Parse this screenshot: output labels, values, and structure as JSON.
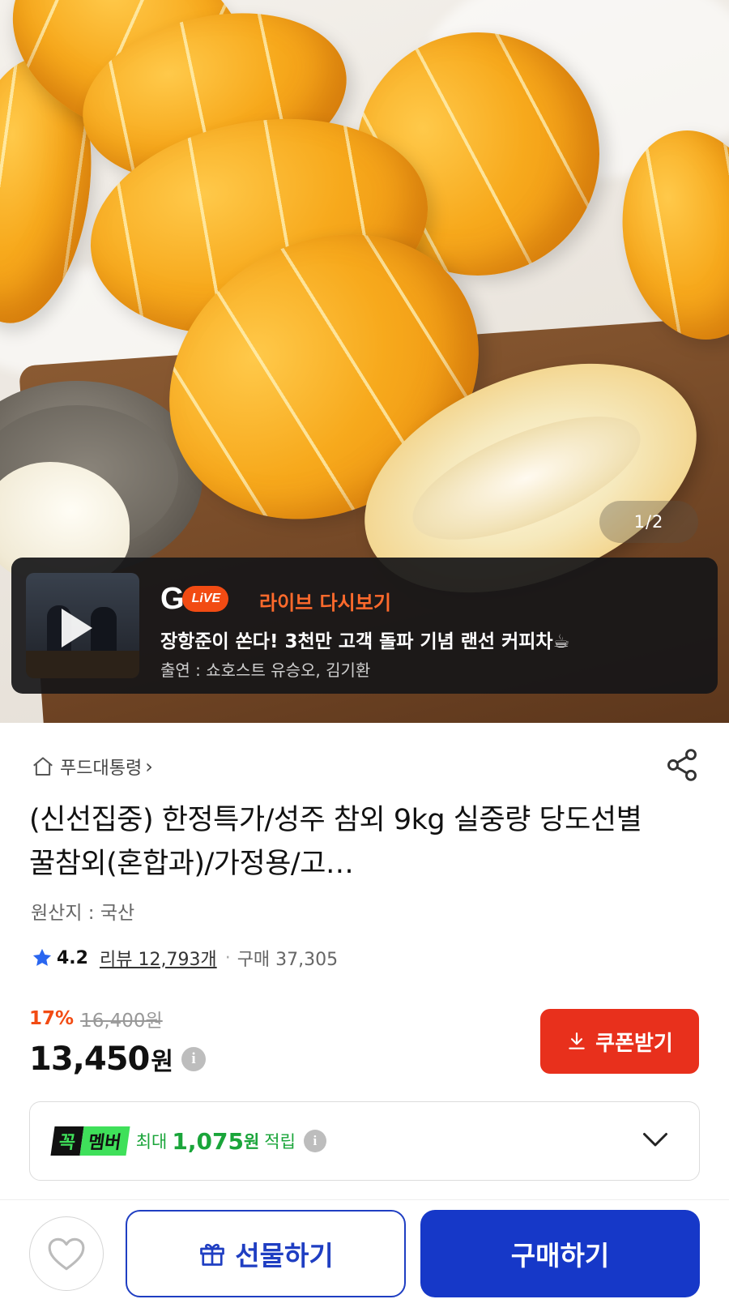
{
  "hero": {
    "pager": "1/2",
    "image_subject": "melons-photo"
  },
  "live": {
    "brand_pill": "LiVE",
    "label": "라이브 다시보기",
    "title": "장항준이 쏜다! 3천만 고객 돌파 기념 랜선 커피차☕",
    "cast": "출연 : 쇼호스트 유승오, 김기환"
  },
  "breadcrumb": {
    "category": "푸드대통령",
    "chevron": "›"
  },
  "product": {
    "title": "(신선집중) 한정특가/성주 참외 9kg 실중량 당도선별 꿀참외(혼합과)/가정용/고…",
    "origin": "원산지 : 국산",
    "rating": "4.2",
    "reviews": "리뷰 12,793개",
    "dot": "·",
    "purchases": "구매 37,305"
  },
  "price": {
    "discount": "17%",
    "original": "16,400원",
    "current": "13,450",
    "currency": "원",
    "info_glyph": "i"
  },
  "coupon": {
    "label": "쿠폰받기"
  },
  "membership": {
    "badge_left": "꼭",
    "badge_right": "멤버",
    "max_label": "최대",
    "amount": "1,075",
    "amount_unit": "원",
    "earn_label": "적립",
    "info_glyph": "i"
  },
  "bottom_bar": {
    "gift_label": "선물하기",
    "buy_label": "구매하기"
  },
  "colors": {
    "accent_blue": "#1638c8",
    "coupon_red": "#e8301c",
    "discount_orange": "#f24b13",
    "member_green": "#3fe05a"
  }
}
